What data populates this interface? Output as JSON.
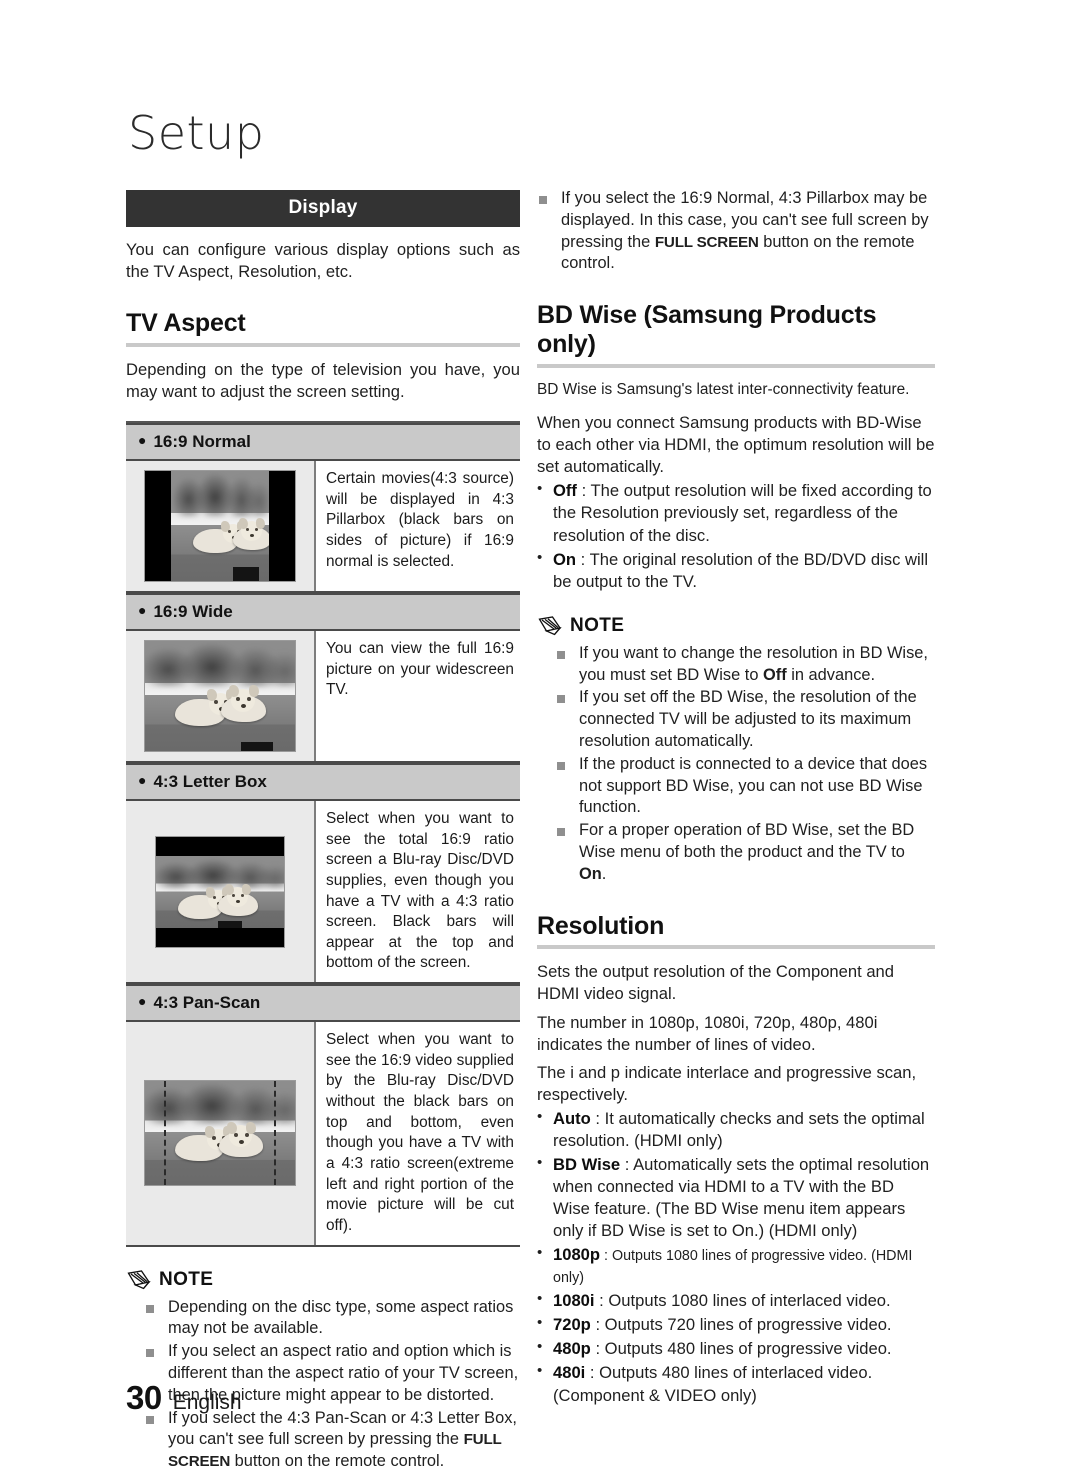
{
  "chapter": {
    "title": "Setup"
  },
  "section": {
    "label": "Display"
  },
  "intro": "You can configure various display options such as the TV Aspect, Resolution, etc.",
  "tv_aspect": {
    "heading": "TV Aspect",
    "intro": "Depending on the type of television you have, you may want to adjust the screen setting.",
    "rows": [
      {
        "label": "16:9 Normal",
        "image_mode": "pillarbox",
        "text": "Certain movies(4:3 source) will be displayed in 4:3 Pillarbox (black bars on sides of picture) if 16:9 normal is selected."
      },
      {
        "label": "16:9 Wide",
        "image_mode": "full",
        "text": "You can view the full 16:9 picture on your widescreen TV."
      },
      {
        "label": "4:3 Letter Box",
        "image_mode": "letterbox",
        "text": "Select when you want to see the total 16:9 ratio screen a Blu-ray Disc/DVD supplies, even though you have a TV with a 4:3 ratio screen. Black bars will appear at the top and bottom of the screen."
      },
      {
        "label": "4:3 Pan-Scan",
        "image_mode": "panscan",
        "text": "Select when you want to see the 16:9 video supplied by the Blu-ray Disc/DVD without the black bars on top and bottom, even though you have a TV with a 4:3 ratio screen(extreme left and right portion of the movie picture will be cut off)."
      }
    ]
  },
  "note_label": "NOTE",
  "tv_aspect_notes": [
    {
      "text": "Depending on the disc type, some aspect ratios may not be available."
    },
    {
      "text": "If you select an aspect ratio and option which is different than the aspect ratio of your TV screen, then the picture might appear to be distorted."
    },
    {
      "prefix": "If you select the 4:3 Pan-Scan or 4:3 Letter Box, you can't see full screen by pressing the ",
      "bold": "FULL SCREEN",
      "suffix": " button on the remote control."
    }
  ],
  "top_right_note": {
    "prefix": "If you select the 16:9 Normal, 4:3 Pillarbox may be displayed. In this case, you can't see full screen by pressing the ",
    "bold": "FULL SCREEN",
    "suffix": " button on the remote control."
  },
  "bd_wise": {
    "heading": "BD Wise (Samsung Products only)",
    "lead": "BD Wise is Samsung's latest inter-connectivity feature.",
    "body": "When you connect Samsung products with BD-Wise to each other via HDMI, the optimum resolution will be set automatically.",
    "options": [
      {
        "name": "Off",
        "sep": " : ",
        "desc": "The output resolution will be fixed according to the Resolution previously set, regardless of the resolution of the disc."
      },
      {
        "name": "On",
        "sep": " : ",
        "desc": "The original resolution of the BD/DVD disc will be output to the TV."
      }
    ],
    "notes": [
      {
        "prefix": "If you want to change the resolution in BD Wise, you must set BD Wise to ",
        "bold": "Off",
        "suffix": " in advance."
      },
      {
        "text": "If you set off the BD Wise, the resolution of the connected TV will be adjusted to its maximum resolution automatically."
      },
      {
        "text": "If the product is connected to a device that does not support BD Wise, you can not use BD Wise function."
      },
      {
        "prefix": "For a proper operation of BD Wise, set the BD Wise menu of both the product and the TV to ",
        "bold": "On",
        "suffix": ".",
        "small": true
      }
    ]
  },
  "resolution": {
    "heading": "Resolution",
    "paras": [
      "Sets the output resolution of the Component and HDMI video signal.",
      "The number in 1080p, 1080i, 720p, 480p, 480i indicates the number of lines of video.",
      "The i and p indicate interlace and progressive scan, respectively."
    ],
    "options": [
      {
        "name": "Auto",
        "sep": " : ",
        "desc": "It automatically checks and sets the optimal resolution. (HDMI only)"
      },
      {
        "name": "BD Wise",
        "sep": " : ",
        "desc": "Automatically sets the optimal resolution when connected via HDMI to a TV with the BD Wise feature. (The BD Wise menu item appears only if BD Wise is set to On.) (HDMI only)"
      },
      {
        "name": "1080p",
        "sep": " : ",
        "desc": "Outputs 1080 lines of progressive video. (HDMI only)",
        "small": true
      },
      {
        "name": "1080i",
        "sep": " : ",
        "desc": "Outputs 1080 lines of interlaced video."
      },
      {
        "name": "720p",
        "sep": " : ",
        "desc": "Outputs 720 lines of progressive video."
      },
      {
        "name": "480p",
        "sep": " : ",
        "desc": "Outputs 480 lines of progressive video."
      },
      {
        "name": "480i",
        "sep": " : ",
        "desc": "Outputs 480 lines of interlaced video. (Component & VIDEO only)"
      }
    ]
  },
  "footer": {
    "page": "30",
    "language": "English"
  }
}
